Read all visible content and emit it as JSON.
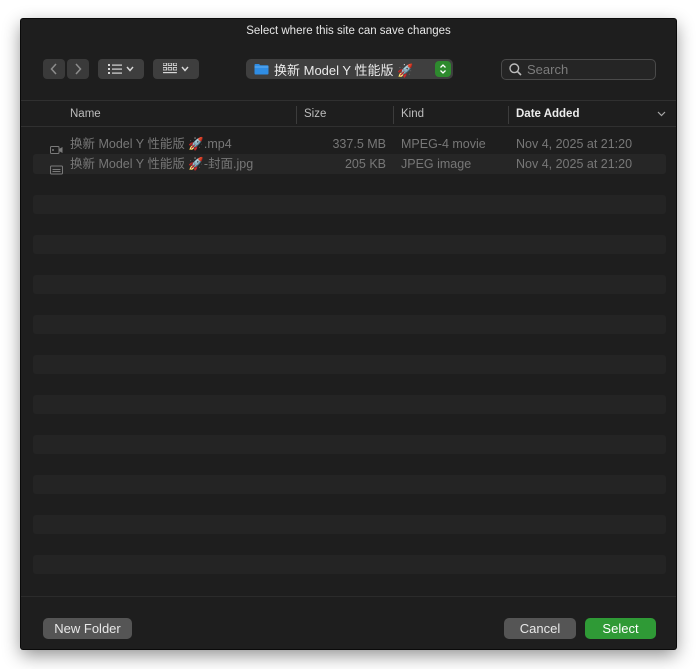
{
  "dialog": {
    "title": "Select where this site can save changes"
  },
  "toolbar": {
    "back_icon": "chevron-left-icon",
    "forward_icon": "chevron-right-icon",
    "view_list_icon": "list-view-icon",
    "view_grid_icon": "grid-view-icon",
    "location": {
      "label": "换新 Model Y 性能版 🚀",
      "icon": "folder-icon",
      "folder_color": "#2f8de4"
    },
    "search": {
      "placeholder": "Search",
      "value": ""
    }
  },
  "table": {
    "columns": {
      "name": "Name",
      "size": "Size",
      "kind": "Kind",
      "date_added": "Date Added"
    },
    "sorted_by": "Date Added",
    "rows": [
      {
        "icon": "video-file-icon",
        "name": "换新 Model Y 性能版 🚀.mp4",
        "size": "337.5 MB",
        "kind": "MPEG-4 movie",
        "date_added": "Nov 4, 2025 at 21:20"
      },
      {
        "icon": "image-file-icon",
        "name": "换新 Model Y 性能版 🚀-封面.jpg",
        "size": "205 KB",
        "kind": "JPEG image",
        "date_added": "Nov 4, 2025 at 21:20"
      }
    ]
  },
  "footer": {
    "new_folder_label": "New Folder",
    "cancel_label": "Cancel",
    "select_label": "Select"
  },
  "colors": {
    "accent": "#2f9a36",
    "background": "#1e1e1e"
  }
}
